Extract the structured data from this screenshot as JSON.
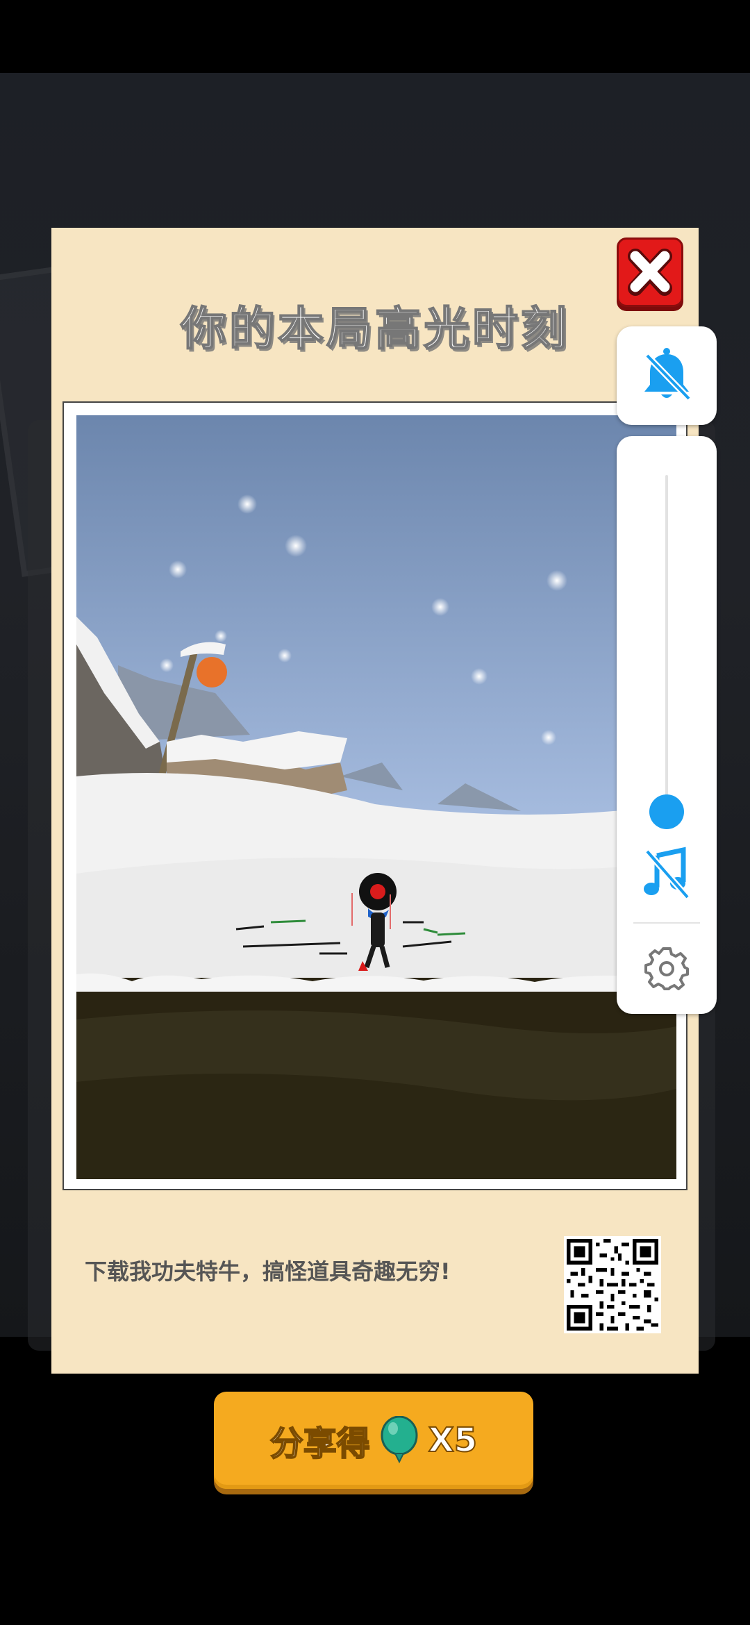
{
  "card": {
    "title": "你的本局高光时刻",
    "footer_text": "下载我功夫特牛，搞怪道具奇趣无穷!"
  },
  "share_button": {
    "label": "分享得",
    "multiplier": "X5"
  },
  "side_panel": {
    "bell_icon": "bell-off-icon",
    "music_icon": "music-off-icon",
    "settings_icon": "gear-icon",
    "volume_level": 0.0
  },
  "colors": {
    "accent": "#1a9ff0",
    "share_button": "#f5aa1f",
    "close_button": "#e21919",
    "card_bg": "#f7e5c2"
  }
}
